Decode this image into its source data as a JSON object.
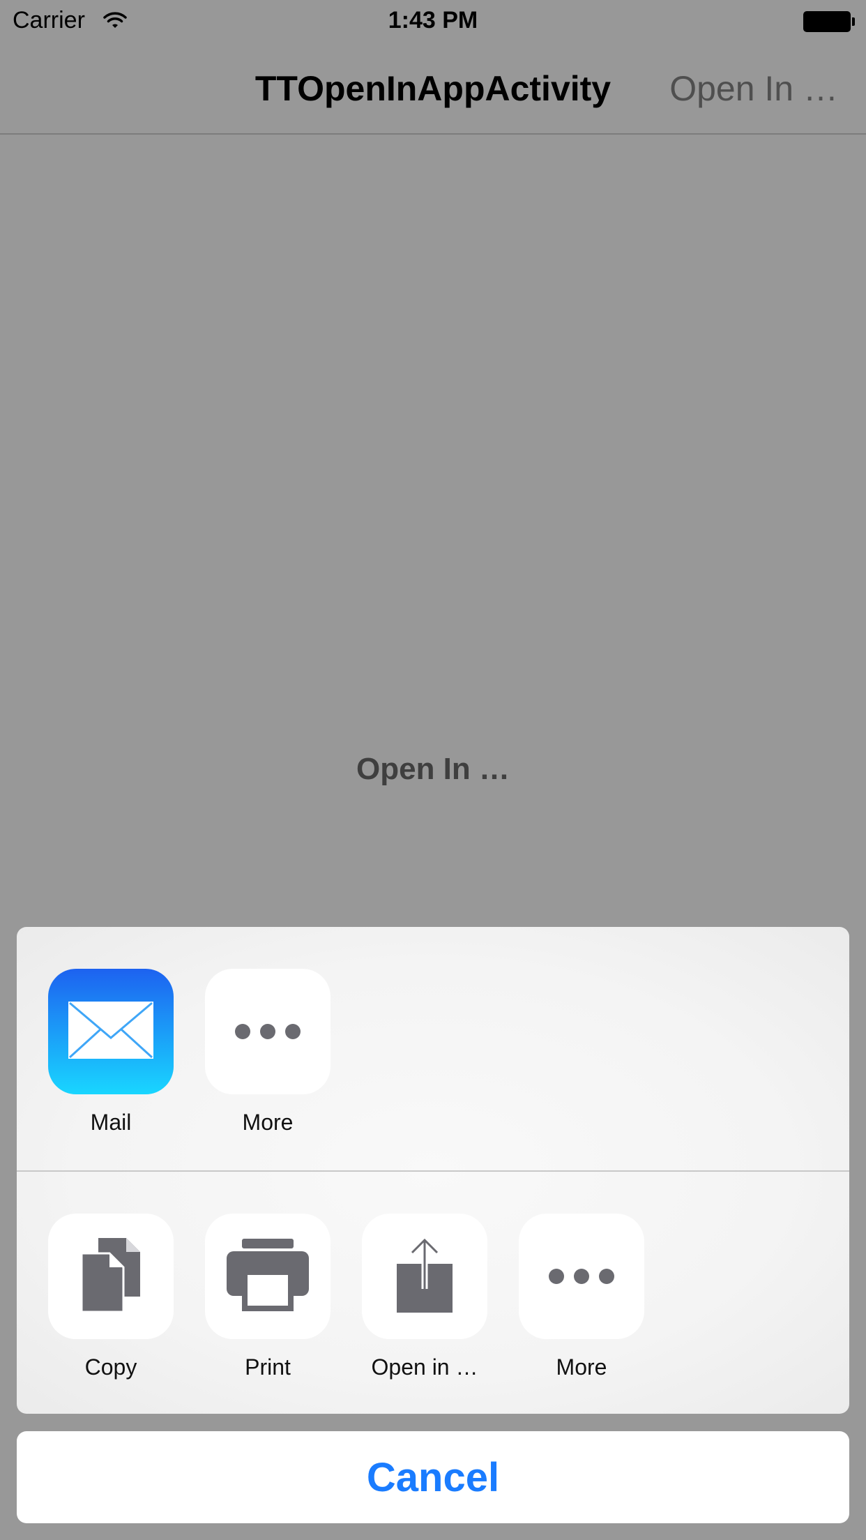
{
  "status_bar": {
    "carrier": "Carrier",
    "time": "1:43 PM"
  },
  "nav_bar": {
    "title": "TTOpenInAppActivity",
    "right_button": "Open In …"
  },
  "content": {
    "open_in_button": "Open In …"
  },
  "share_sheet": {
    "share_row": [
      {
        "label": "Mail",
        "icon": "mail-icon"
      },
      {
        "label": "More",
        "icon": "more-dots-icon"
      }
    ],
    "action_row": [
      {
        "label": "Copy",
        "icon": "copy-icon"
      },
      {
        "label": "Print",
        "icon": "print-icon"
      },
      {
        "label": "Open in …",
        "icon": "share-upload-icon"
      },
      {
        "label": "More",
        "icon": "more-dots-icon"
      }
    ],
    "cancel_label": "Cancel"
  },
  "colors": {
    "dim_overlay": "#989898",
    "accent": "#1a7cff",
    "mail_gradient_top": "#1d62f0",
    "mail_gradient_bottom": "#19d6ff",
    "icon_gray": "#6a6a70"
  }
}
